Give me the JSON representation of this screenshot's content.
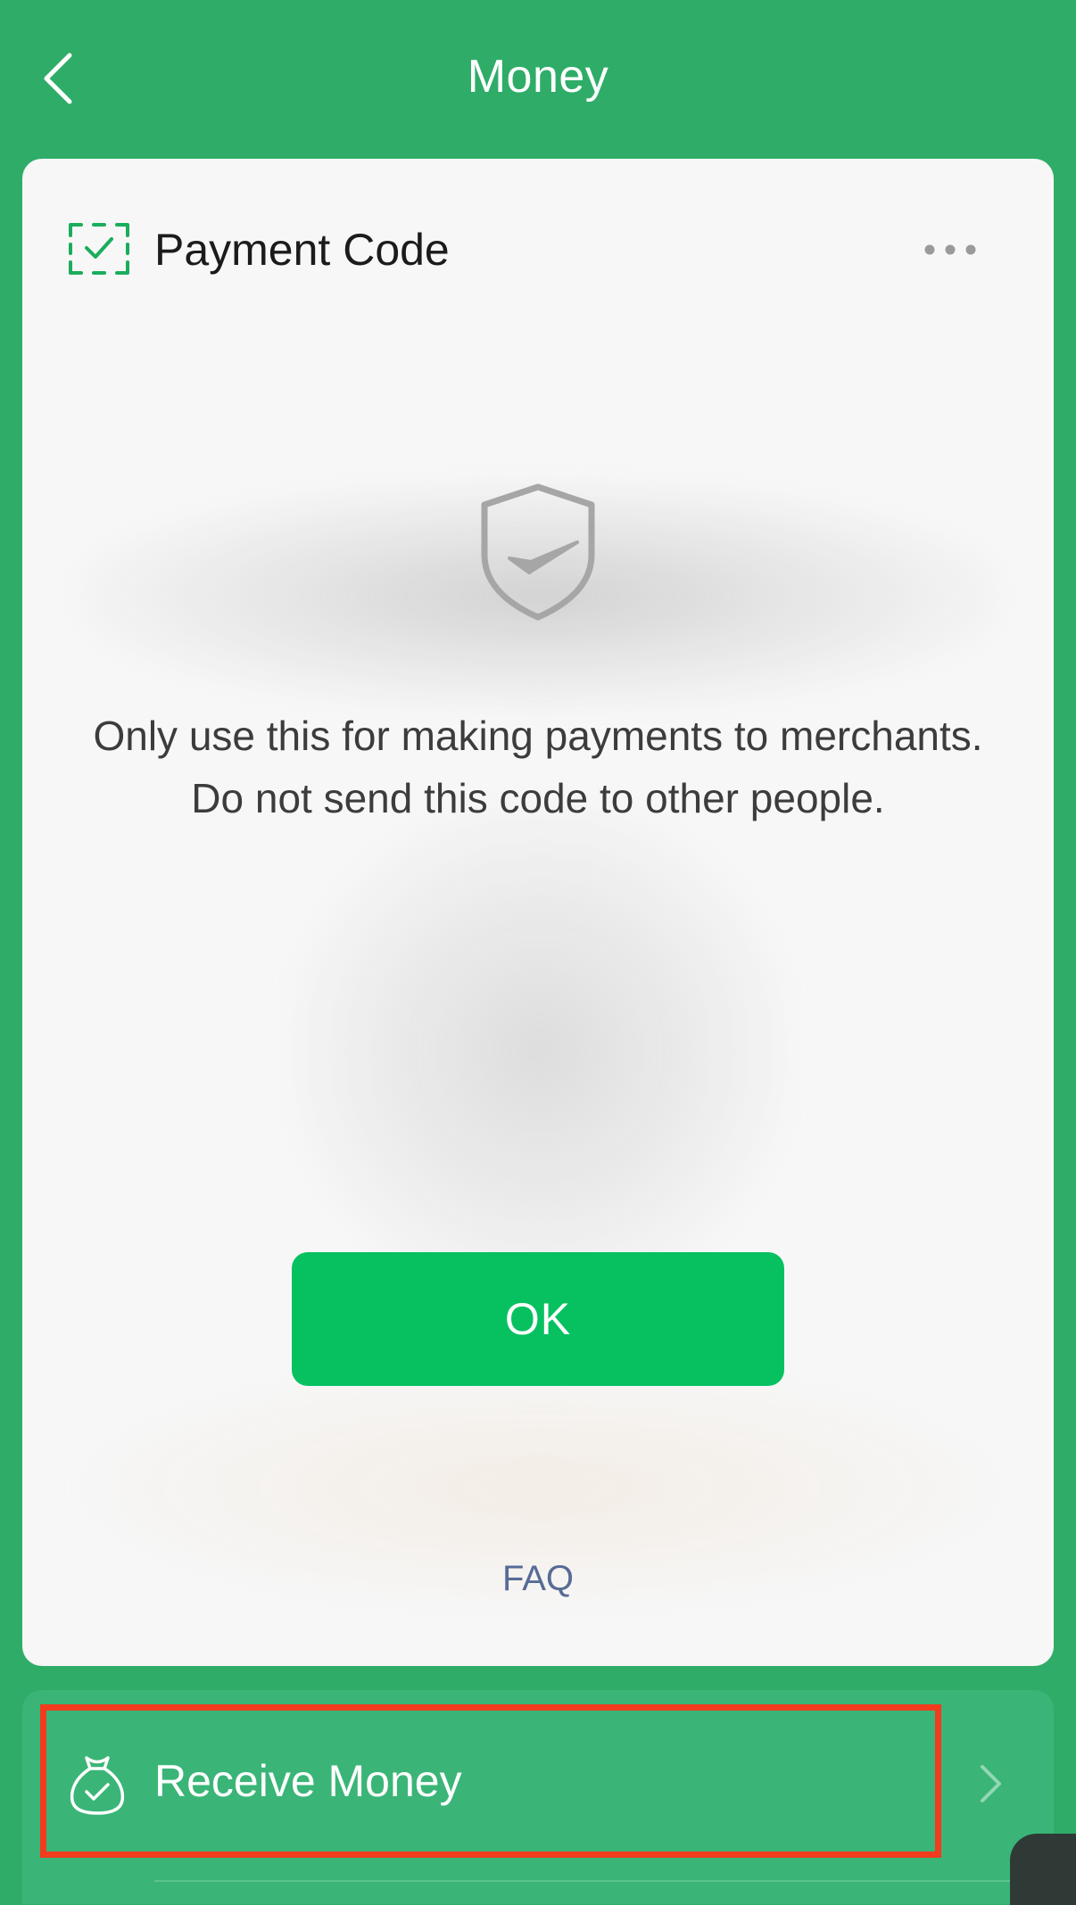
{
  "nav": {
    "title": "Money"
  },
  "card": {
    "title": "Payment Code",
    "notice": "Only use this for making payments to merchants. Do not send this code to other people.",
    "ok_label": "OK",
    "faq_label": "FAQ"
  },
  "receive": {
    "label": "Receive Money"
  },
  "colors": {
    "brand_green": "#07c160",
    "background_green": "#2fad68",
    "link_blue": "#576b95",
    "highlight_red": "#f33b1d"
  },
  "icons": {
    "back": "chevron-left-icon",
    "payment_code": "scan-check-icon",
    "more": "more-dots-icon",
    "shield": "shield-check-icon",
    "receive": "money-bag-icon",
    "arrow": "chevron-right-icon"
  }
}
